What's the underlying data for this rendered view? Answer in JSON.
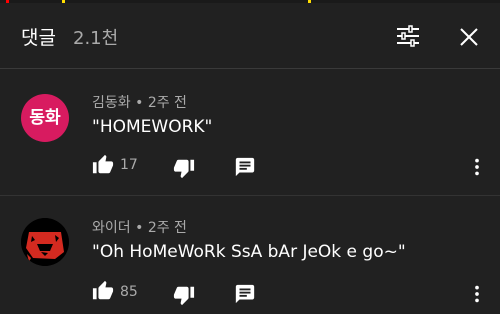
{
  "header": {
    "title": "댓글",
    "count": "2.1천"
  },
  "colors": {
    "background": "#212121",
    "text_primary": "#ffffff",
    "text_secondary": "#aaaaaa",
    "avatar_1": "#d81b60",
    "strip_red": "#ff0000",
    "strip_yellow": "#ffdd00"
  },
  "icons": {
    "filter": "sort-filter-icon",
    "close": "close-icon",
    "like": "thumb-up-icon",
    "dislike": "thumb-down-icon",
    "reply": "reply-comment-icon",
    "more": "more-vert-icon"
  },
  "comments": [
    {
      "avatar_text": "동화",
      "author": "김동화",
      "time": "2주 전",
      "text": "\"HOMEWORK\"",
      "likes": "17"
    },
    {
      "avatar_text": "",
      "author": "와이더",
      "time": "2주 전",
      "text": "\"Oh HoMeWoRk SsA bAr JeOk e go~\"",
      "likes": "85"
    }
  ]
}
